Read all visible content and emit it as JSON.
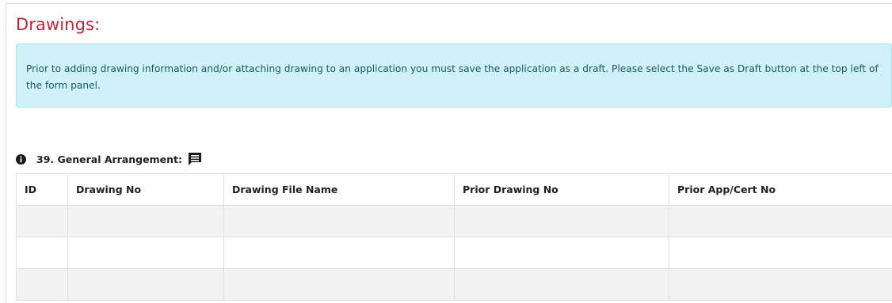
{
  "section": {
    "title": "Drawings:"
  },
  "alert": {
    "text": "Prior to adding drawing information and/or attaching drawing to an application you must save the application as a draft. Please select the Save as Draft button at the top left of the form panel."
  },
  "arrangement": {
    "label": "39. General Arrangement:",
    "info_icon": "info-circle-icon",
    "comment_icon": "comment-icon"
  },
  "table": {
    "columns": [
      "ID",
      "Drawing No",
      "Drawing File Name",
      "Prior Drawing No",
      "Prior App/Cert No"
    ],
    "rows": [
      [
        "",
        "",
        "",
        "",
        ""
      ],
      [
        "",
        "",
        "",
        "",
        ""
      ],
      [
        "",
        "",
        "",
        "",
        ""
      ]
    ]
  },
  "colors": {
    "title": "#c0263b",
    "alert_bg": "#d1f1f8",
    "alert_text": "#165b67",
    "row_stripe": "#f2f2f2"
  }
}
